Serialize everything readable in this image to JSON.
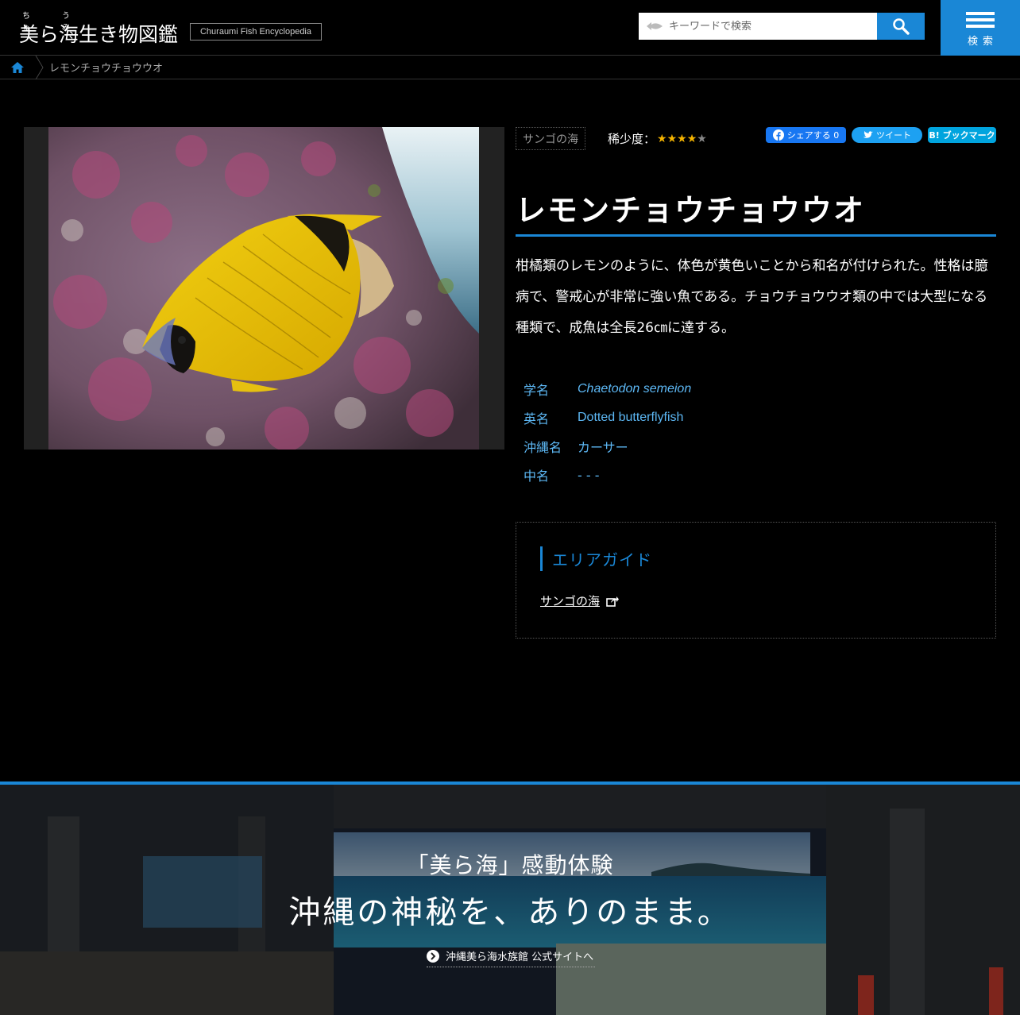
{
  "header": {
    "ruby_chu": "ちゅ",
    "ruby_umi": "うみ",
    "logo_title": "美ら海生き物図鑑",
    "logo_sub": "Churaumi Fish Encyclopedia",
    "search_placeholder": "キーワードで検索",
    "menu_label": "検索"
  },
  "breadcrumb": {
    "current": "レモンチョウチョウウオ"
  },
  "species": {
    "tag": "サンゴの海",
    "rarity_label": "稀少度：",
    "rarity_value": 4,
    "rarity_max": 5,
    "title": "レモンチョウチョウウオ",
    "description": "柑橘類のレモンのように、体色が黄色いことから和名が付けられた。性格は臆病で、警戒心が非常に強い魚である。チョウチョウウオ類の中では大型になる種類で、成魚は全長26㎝に達する。",
    "names": [
      {
        "label": "学名",
        "value": "Chaetodon semeion"
      },
      {
        "label": "英名",
        "value": "Dotted butterflyfish"
      },
      {
        "label": "沖縄名",
        "value": "カーサー"
      },
      {
        "label": "中名",
        "value": "- - -"
      }
    ]
  },
  "social": {
    "facebook": "シェアする 0",
    "twitter": "ツイート",
    "hatena": "B! ブックマーク"
  },
  "area_guide": {
    "title": "エリアガイド",
    "link": "サンゴの海"
  },
  "banner": {
    "sub": "「美ら海」感動体験",
    "main": "沖縄の神秘を、ありのまま。",
    "link": "沖縄美ら海水族館 公式サイトへ"
  },
  "colors": {
    "accent": "#1a87d6",
    "name_text": "#5db8f5",
    "star": "#f5b400"
  }
}
